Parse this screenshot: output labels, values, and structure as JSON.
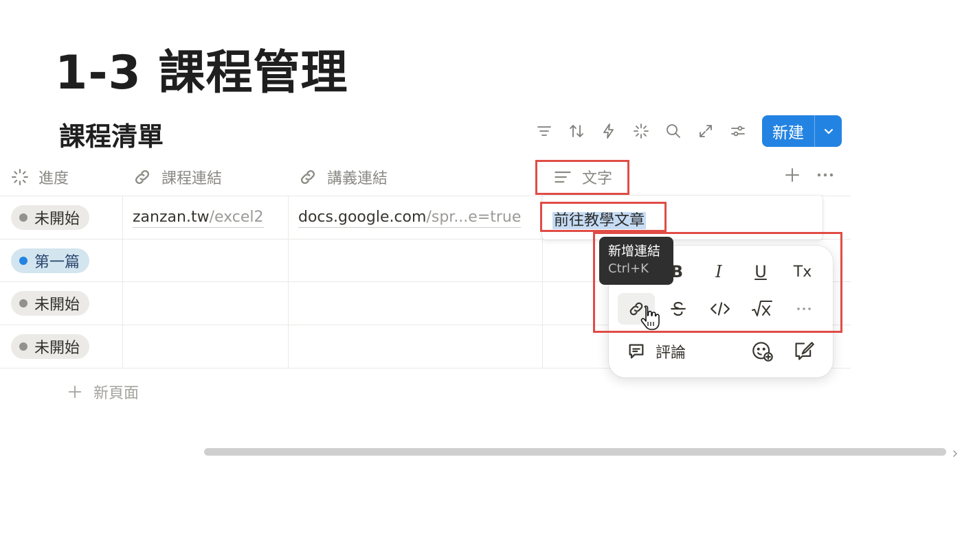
{
  "page": {
    "title": "1-3 課程管理"
  },
  "database": {
    "title": "課程清單",
    "toolbar": {
      "icons": [
        "filter-icon",
        "sort-icon",
        "automation-icon",
        "ai-sparkle-icon",
        "search-icon",
        "expand-icon",
        "settings-sliders-icon"
      ],
      "new_button_label": "新建"
    },
    "columns": [
      {
        "label": "進度",
        "icon": "status-icon"
      },
      {
        "label": "課程連結",
        "icon": "link-icon"
      },
      {
        "label": "講義連結",
        "icon": "link-icon"
      },
      {
        "label": "文字",
        "icon": "text-lines-icon"
      }
    ],
    "rows": [
      {
        "status": "未開始",
        "status_color": "gray",
        "course_link_domain": "zanzan.tw",
        "course_link_path": "/excel2",
        "notes_link_domain": "docs.google.com",
        "notes_link_path": "/spr...e=true",
        "text": "前往教學文章"
      },
      {
        "status": "第一篇",
        "status_color": "blue",
        "course_link_domain": "",
        "course_link_path": "",
        "notes_link_domain": "",
        "notes_link_path": "",
        "text": ""
      },
      {
        "status": "未開始",
        "status_color": "gray",
        "course_link_domain": "",
        "course_link_path": "",
        "notes_link_domain": "",
        "notes_link_path": "",
        "text": ""
      },
      {
        "status": "未開始",
        "status_color": "gray",
        "course_link_domain": "",
        "course_link_path": "",
        "notes_link_domain": "",
        "notes_link_path": "",
        "text": ""
      }
    ],
    "new_page_label": "新頁面"
  },
  "format_menu": {
    "row1": [
      "B",
      "I",
      "U",
      "Tx"
    ],
    "row2": [
      "link-icon",
      "strikethrough-icon",
      "code-icon",
      "math-equation-icon",
      "more-icon"
    ],
    "comment_label": "評論"
  },
  "tooltip": {
    "title": "新增連結",
    "shortcut": "Ctrl+K"
  },
  "colors": {
    "accent": "#2383e2",
    "highlight_box": "#e04c45",
    "selection": "#c6dcf4"
  }
}
